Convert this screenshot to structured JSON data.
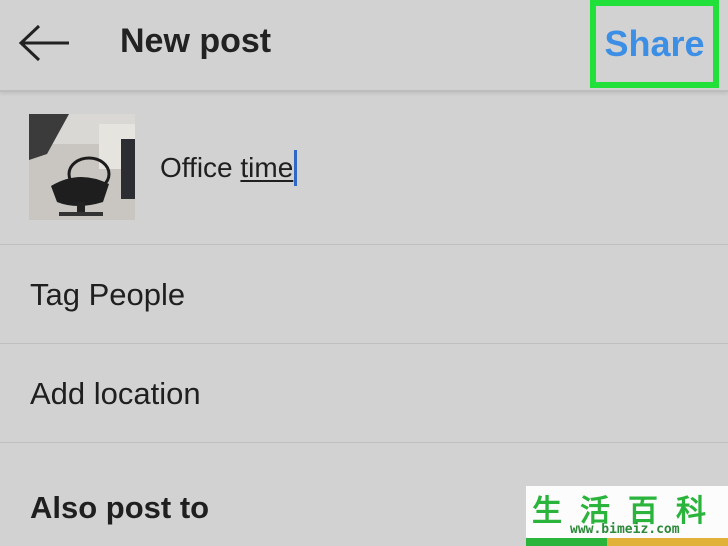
{
  "header": {
    "back_icon": "arrow-left-icon",
    "title": "New post",
    "share_label": "Share",
    "share_color": "#3d8fe6",
    "highlight_color": "#22e03a"
  },
  "caption": {
    "text_plain": "Office ",
    "text_underlined": "time"
  },
  "rows": [
    {
      "label": "Tag People"
    },
    {
      "label": "Add location"
    }
  ],
  "section_title": "Also post to",
  "watermark": {
    "chars": "生活百科",
    "url": "www.bimeiz.com"
  }
}
